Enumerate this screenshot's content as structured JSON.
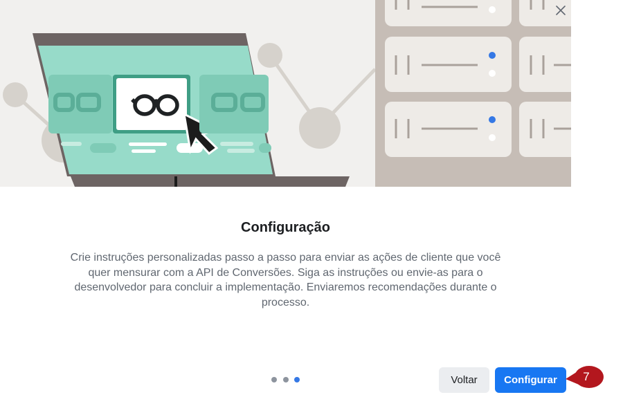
{
  "dialog": {
    "title": "Configuração",
    "description": "Crie instruções personalizadas passo a passo para enviar as ações de cliente que você quer mensurar com a API de Conversões. Siga as instruções ou envie-as para o desenvolvedor para concluir a implementação. Enviaremos recomendações durante o processo.",
    "close_icon": "close-icon",
    "pagination": {
      "total": 3,
      "current": 3
    },
    "buttons": {
      "back_label": "Voltar",
      "primary_label": "Configurar"
    }
  },
  "annotation": {
    "step_number": "7",
    "color": "#b3171e"
  },
  "colors": {
    "primary": "#1877f2",
    "pager_active": "#3578e5",
    "pager_inactive": "#8d949e",
    "hero_background": "#f1f0ee",
    "laptop_screen": "#97dbc9",
    "server_panel": "#c6bdb6"
  }
}
